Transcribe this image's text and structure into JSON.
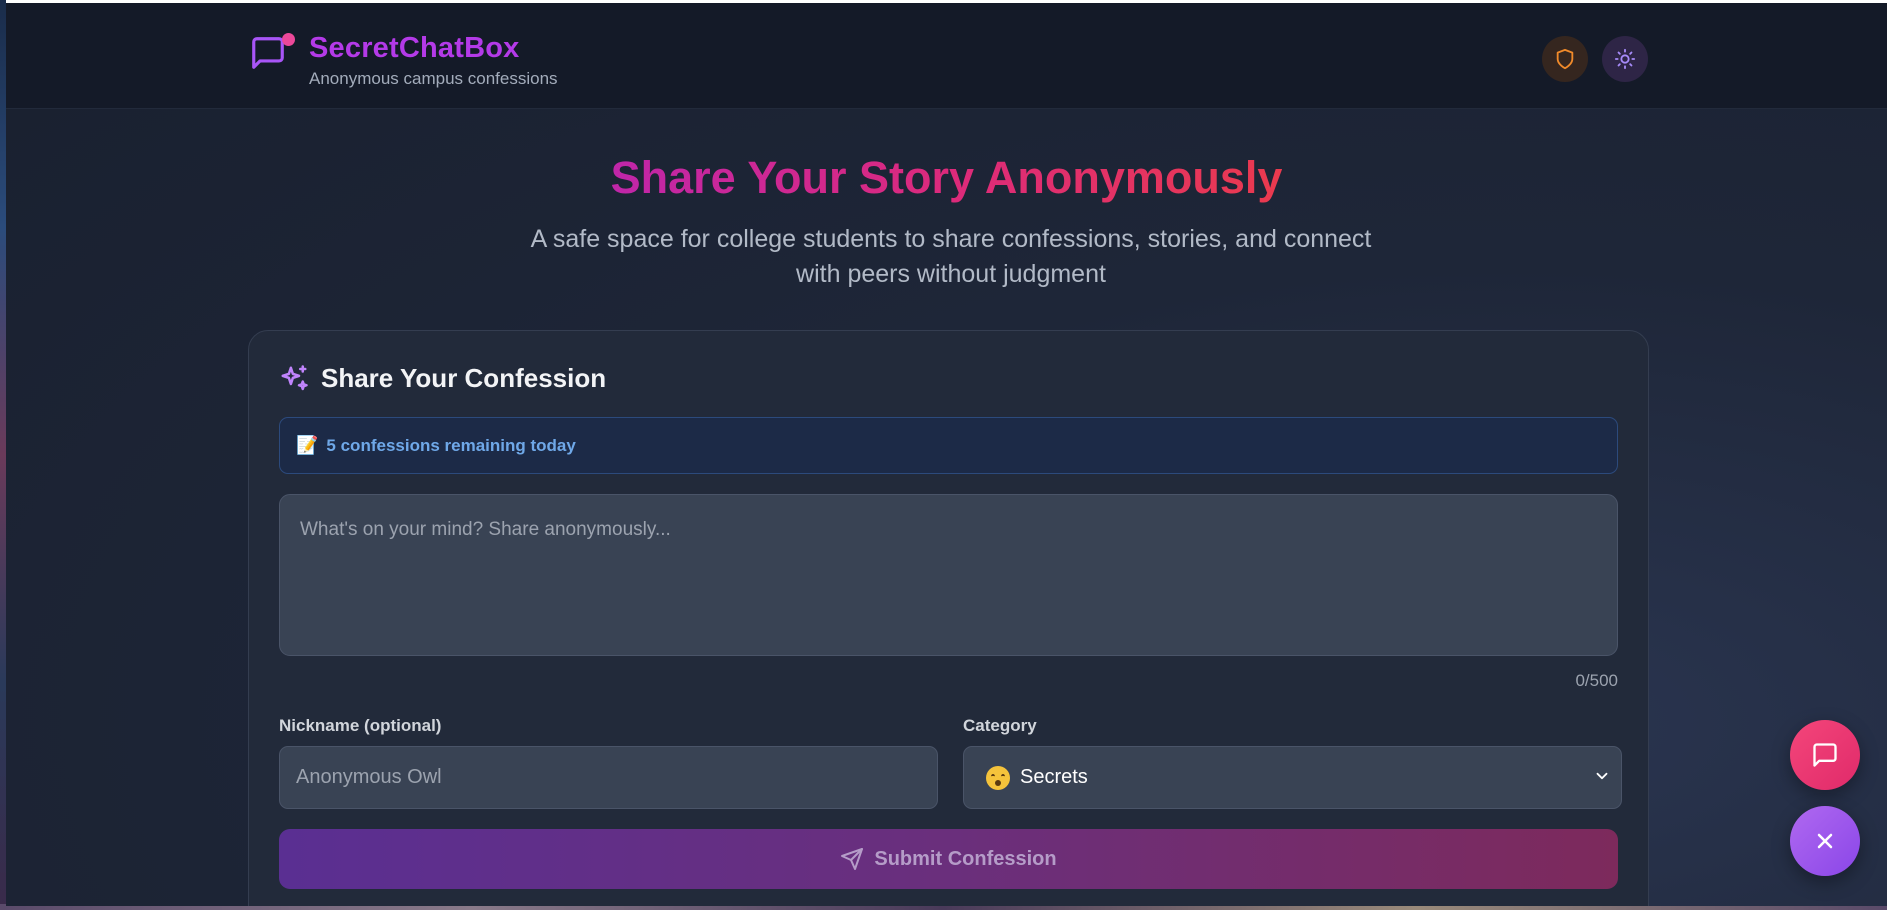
{
  "header": {
    "app_title": "SecretChatBox",
    "app_subtitle": "Anonymous campus confessions",
    "icons": [
      "message-square-icon",
      "shield-icon",
      "sun-icon"
    ]
  },
  "hero": {
    "title": "Share Your Story Anonymously",
    "subtitle": "A safe space for college students to share confessions, stories, and connect with peers without judgment"
  },
  "form": {
    "title": "Share Your Confession",
    "title_icon": "sparkles-icon",
    "notice_emoji": "📝",
    "notice_text": "5 confessions remaining today",
    "textarea_placeholder": "What's on your mind? Share anonymously...",
    "char_counter": "0/500",
    "nickname_label": "Nickname (optional)",
    "nickname_placeholder": "Anonymous Owl",
    "category_label": "Category",
    "category_selected": "Secrets",
    "submit_label": "Submit Confession"
  },
  "fabs": {
    "chat_icon": "message-square-icon",
    "close_icon": "x-icon"
  },
  "colors": {
    "brand": "#b43ae8",
    "accent_pink": "#ec4899",
    "notice_text": "#6fa8e8"
  }
}
